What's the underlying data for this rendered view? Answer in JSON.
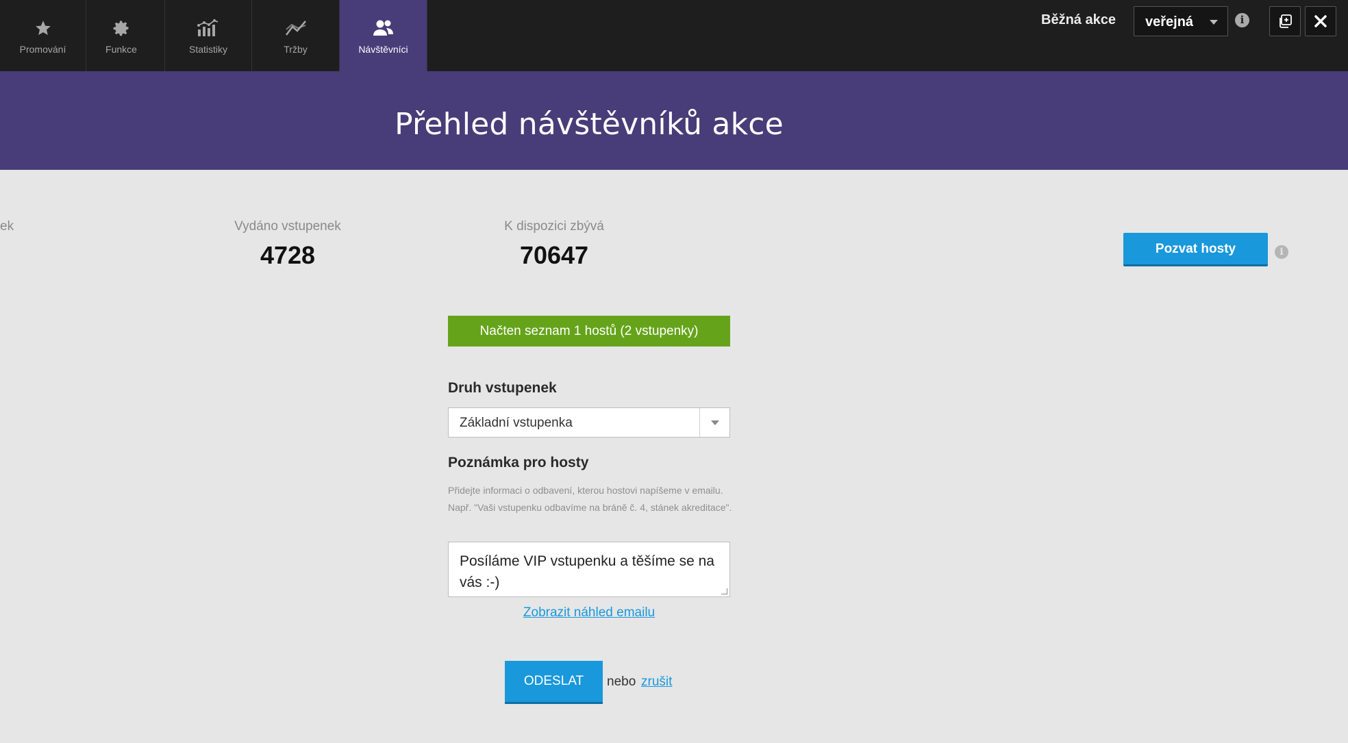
{
  "tabs": [
    {
      "label": "Promování",
      "icon": "star-icon",
      "active": false
    },
    {
      "label": "Funkce",
      "icon": "gear-icon",
      "active": false
    },
    {
      "label": "Statistiky",
      "icon": "bar-chart-icon",
      "active": false
    },
    {
      "label": "Tržby",
      "icon": "line-chart-icon",
      "active": false
    },
    {
      "label": "Návštěvníci",
      "icon": "users-icon",
      "active": true
    }
  ],
  "topbar": {
    "event_type": "Běžná akce",
    "visibility": "veřejná",
    "info_icon": "info-icon",
    "duplicate_icon": "duplicate-icon",
    "close_icon": "close-icon"
  },
  "header": {
    "title": "Přehled návštěvníků akce"
  },
  "stats": {
    "partial_label": "ek",
    "issued_label": "Vydáno vstupenek",
    "issued_value": "4728",
    "remaining_label": "K dispozici zbývá",
    "remaining_value": "70647"
  },
  "actions": {
    "invite_label": "Pozvat hosty"
  },
  "banner": {
    "text": "Načten seznam 1 hostů (2 vstupenky)"
  },
  "form": {
    "ticket_type_label": "Druh vstupenek",
    "ticket_type_value": "Základní vstupenka",
    "note_label": "Poznámka pro hosty",
    "note_hint": "Přidejte informaci o odbavení, kterou hostovi napíšeme v emailu. Např. \"Vaši vstupenku odbavíme na bráně č. 4, stánek akreditace\".",
    "note_value": "Posíláme VIP vstupenku a těšíme se na vás :-)",
    "preview_link": "Zobrazit náhled emailu",
    "submit_label": "ODESLAT",
    "or_text": "nebo",
    "cancel_link": "zrušit"
  },
  "colors": {
    "topbar": "#1e1e1e",
    "accent_purple": "#483d78",
    "primary_blue": "#1998dc",
    "success_green": "#65a41a",
    "background": "#e6e6e6"
  }
}
